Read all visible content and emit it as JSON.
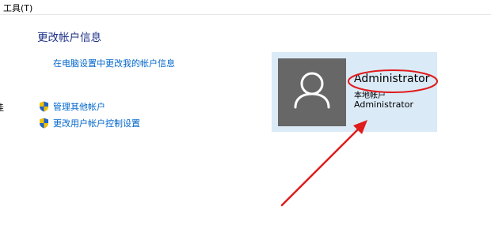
{
  "menubar": {
    "tools_label": "工具(T)"
  },
  "main": {
    "section_title": "更改帐户信息",
    "link_pc_settings": "在电脑设置中更改我的帐户信息"
  },
  "sidebar_partial": {
    "clipped_text": "佳"
  },
  "tasks": [
    {
      "label": "管理其他帐户",
      "icon": "uac-shield-icon"
    },
    {
      "label": "更改用户帐户控制设置",
      "icon": "uac-shield-icon"
    }
  ],
  "account": {
    "name": "Administrator",
    "type": "本地帐户",
    "group": "Administrator",
    "avatar_icon": "user-icon"
  },
  "colors": {
    "title_blue": "#1e3287",
    "link_blue": "#0066cc",
    "card_bg": "#dbeaf7",
    "avatar_bg": "#676767",
    "annotation_red": "#e01b1b"
  }
}
